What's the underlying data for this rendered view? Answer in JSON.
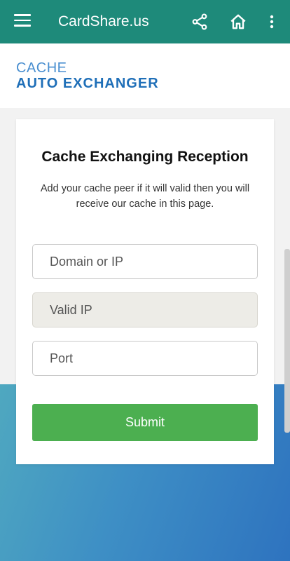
{
  "app_bar": {
    "title": "CardShare.us",
    "icons": [
      "menu-icon",
      "share-icon",
      "home-icon",
      "more-vert-icon"
    ],
    "color": "#1e8a7a"
  },
  "page_header": {
    "subtitle": "CACHE",
    "title": "AUTO EXCHANGER"
  },
  "form_card": {
    "heading": "Cache Exchanging Reception",
    "description": "Add your cache peer if it will valid then you will receive our cache in this page.",
    "fields": {
      "domain": {
        "placeholder": "Domain or IP"
      },
      "valid_ip": {
        "placeholder": "Valid IP"
      },
      "port": {
        "placeholder": "Port"
      }
    },
    "submit_label": "Submit",
    "submit_color": "#4caf50"
  }
}
